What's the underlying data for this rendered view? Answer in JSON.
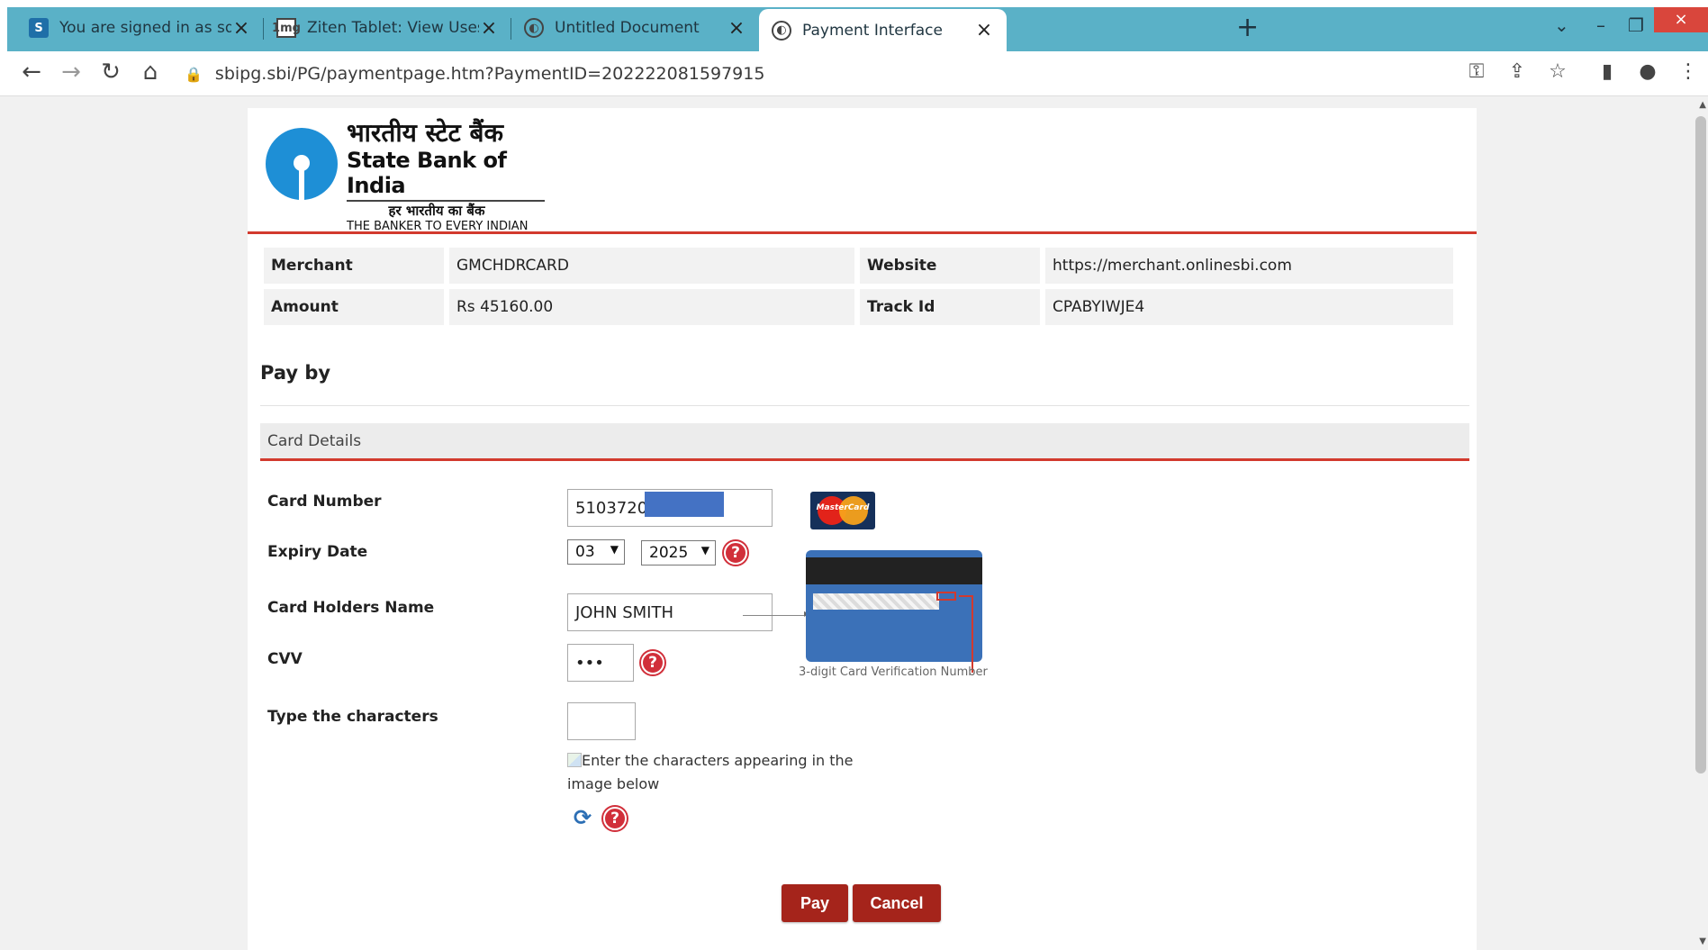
{
  "browser": {
    "tabs": [
      {
        "title": "You are signed in as sdcruz",
        "favicon": "S",
        "icon": "s-icon",
        "active": false
      },
      {
        "title": "Ziten Tablet: View Uses, Side Effe",
        "favicon": "1mg",
        "icon": "document-icon",
        "active": false
      },
      {
        "title": "Untitled Document",
        "favicon": "",
        "icon": "globe-icon",
        "active": false
      },
      {
        "title": "Payment Interface",
        "favicon": "",
        "icon": "globe-icon",
        "active": true
      }
    ],
    "close_glyph": "×",
    "new_tab_glyph": "+",
    "url": "sbipg.sbi/PG/paymentpage.htm?PaymentID=202222081597915"
  },
  "bank": {
    "name_hindi": "भारतीय स्टेट बैंक",
    "name_english": "State Bank of India",
    "tagline_hindi": "हर भारतीय का बैंक",
    "tagline_english": "THE BANKER TO EVERY INDIAN",
    "brand_color": "#1e8fd6"
  },
  "merchant_info": {
    "merchant_label": "Merchant",
    "merchant_value": "GMCHDRCARD",
    "website_label": "Website",
    "website_value": "https://merchant.onlinesbi.com",
    "amount_label": "Amount",
    "amount_value": "Rs 45160.00",
    "track_label": "Track Id",
    "track_value": "CPABYIWJE4"
  },
  "form": {
    "pay_by": "Pay by",
    "section_title": "Card Details",
    "card_number_label": "Card Number",
    "card_number_value": "5103720",
    "card_brand": "MasterCard",
    "expiry_label": "Expiry Date",
    "expiry_month": "03",
    "expiry_year": "2025",
    "holder_label": "Card Holders Name",
    "holder_value": "JOHN SMITH",
    "cvv_label": "CVV",
    "cvv_value": "•••",
    "cvv_caption": "3-digit Card Verification Number",
    "captcha_label": "Type the characters",
    "captcha_alt": "Enter the characters appearing in the image below",
    "help_glyph": "?",
    "refresh_glyph": "⟳"
  },
  "actions": {
    "pay": "Pay",
    "cancel": "Cancel"
  },
  "colors": {
    "accent_red": "#d23a2e",
    "button": "#a5241b",
    "tabbar": "#5ab1c7"
  }
}
